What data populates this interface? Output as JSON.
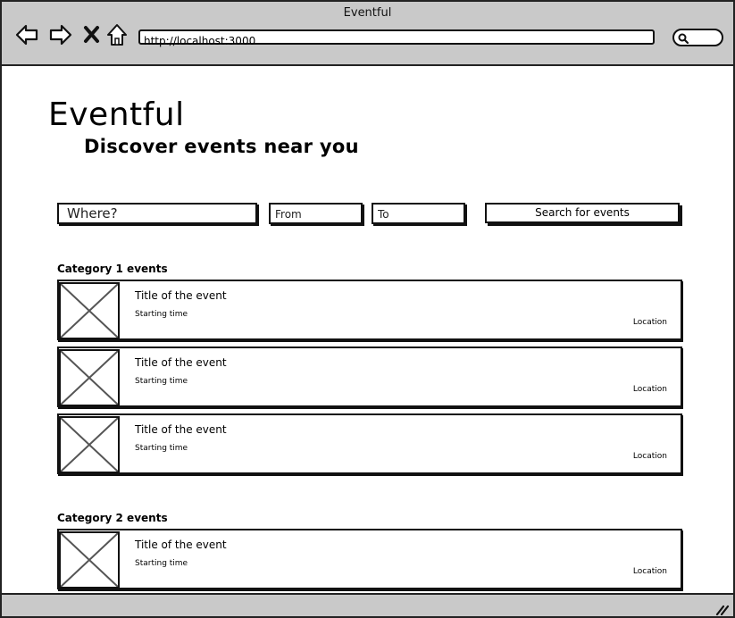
{
  "window": {
    "title": "Eventful"
  },
  "browser": {
    "url": "http://localhost:3000",
    "nav_icons": [
      "back-arrow-icon",
      "forward-arrow-icon",
      "close-icon",
      "home-icon"
    ],
    "search_icon": "search-icon"
  },
  "header": {
    "title": "Eventful",
    "subtitle": "Discover events near you"
  },
  "search": {
    "where_placeholder": "Where?",
    "from_placeholder": "From",
    "to_placeholder": "To",
    "button_label": "Search for events"
  },
  "categories": [
    {
      "heading": "Category 1 events",
      "events": [
        {
          "title": "Title of the event",
          "time": "Starting time",
          "location": "Location"
        },
        {
          "title": "Title of the event",
          "time": "Starting time",
          "location": "Location"
        },
        {
          "title": "Title of the event",
          "time": "Starting time",
          "location": "Location"
        }
      ]
    },
    {
      "heading": "Category 2 events",
      "events": [
        {
          "title": "Title of the event",
          "time": "Starting time",
          "location": "Location"
        }
      ]
    }
  ],
  "colors": {
    "chrome": "#c9c9c9",
    "border": "#111111",
    "placeholder_image_stroke": "#555555"
  }
}
